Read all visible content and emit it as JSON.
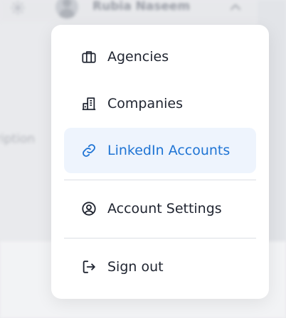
{
  "header": {
    "username": "Rubia Naseem",
    "gear_icon": "gear-icon",
    "chevron_icon": "chevron-up-icon"
  },
  "background": {
    "partial_text": "ription"
  },
  "menu": {
    "items": [
      {
        "label": "Agencies",
        "icon": "briefcase-icon",
        "active": false
      },
      {
        "label": "Companies",
        "icon": "building-icon",
        "active": false
      },
      {
        "label": "LinkedIn Accounts",
        "icon": "link-icon",
        "active": true
      },
      {
        "label": "Account Settings",
        "icon": "user-circle-icon",
        "active": false
      },
      {
        "label": "Sign out",
        "icon": "sign-out-icon",
        "active": false
      }
    ]
  },
  "colors": {
    "accent": "#1f74d4",
    "active_bg": "#eef4fd",
    "text": "#1f2430",
    "divider": "#dcdfe4"
  }
}
